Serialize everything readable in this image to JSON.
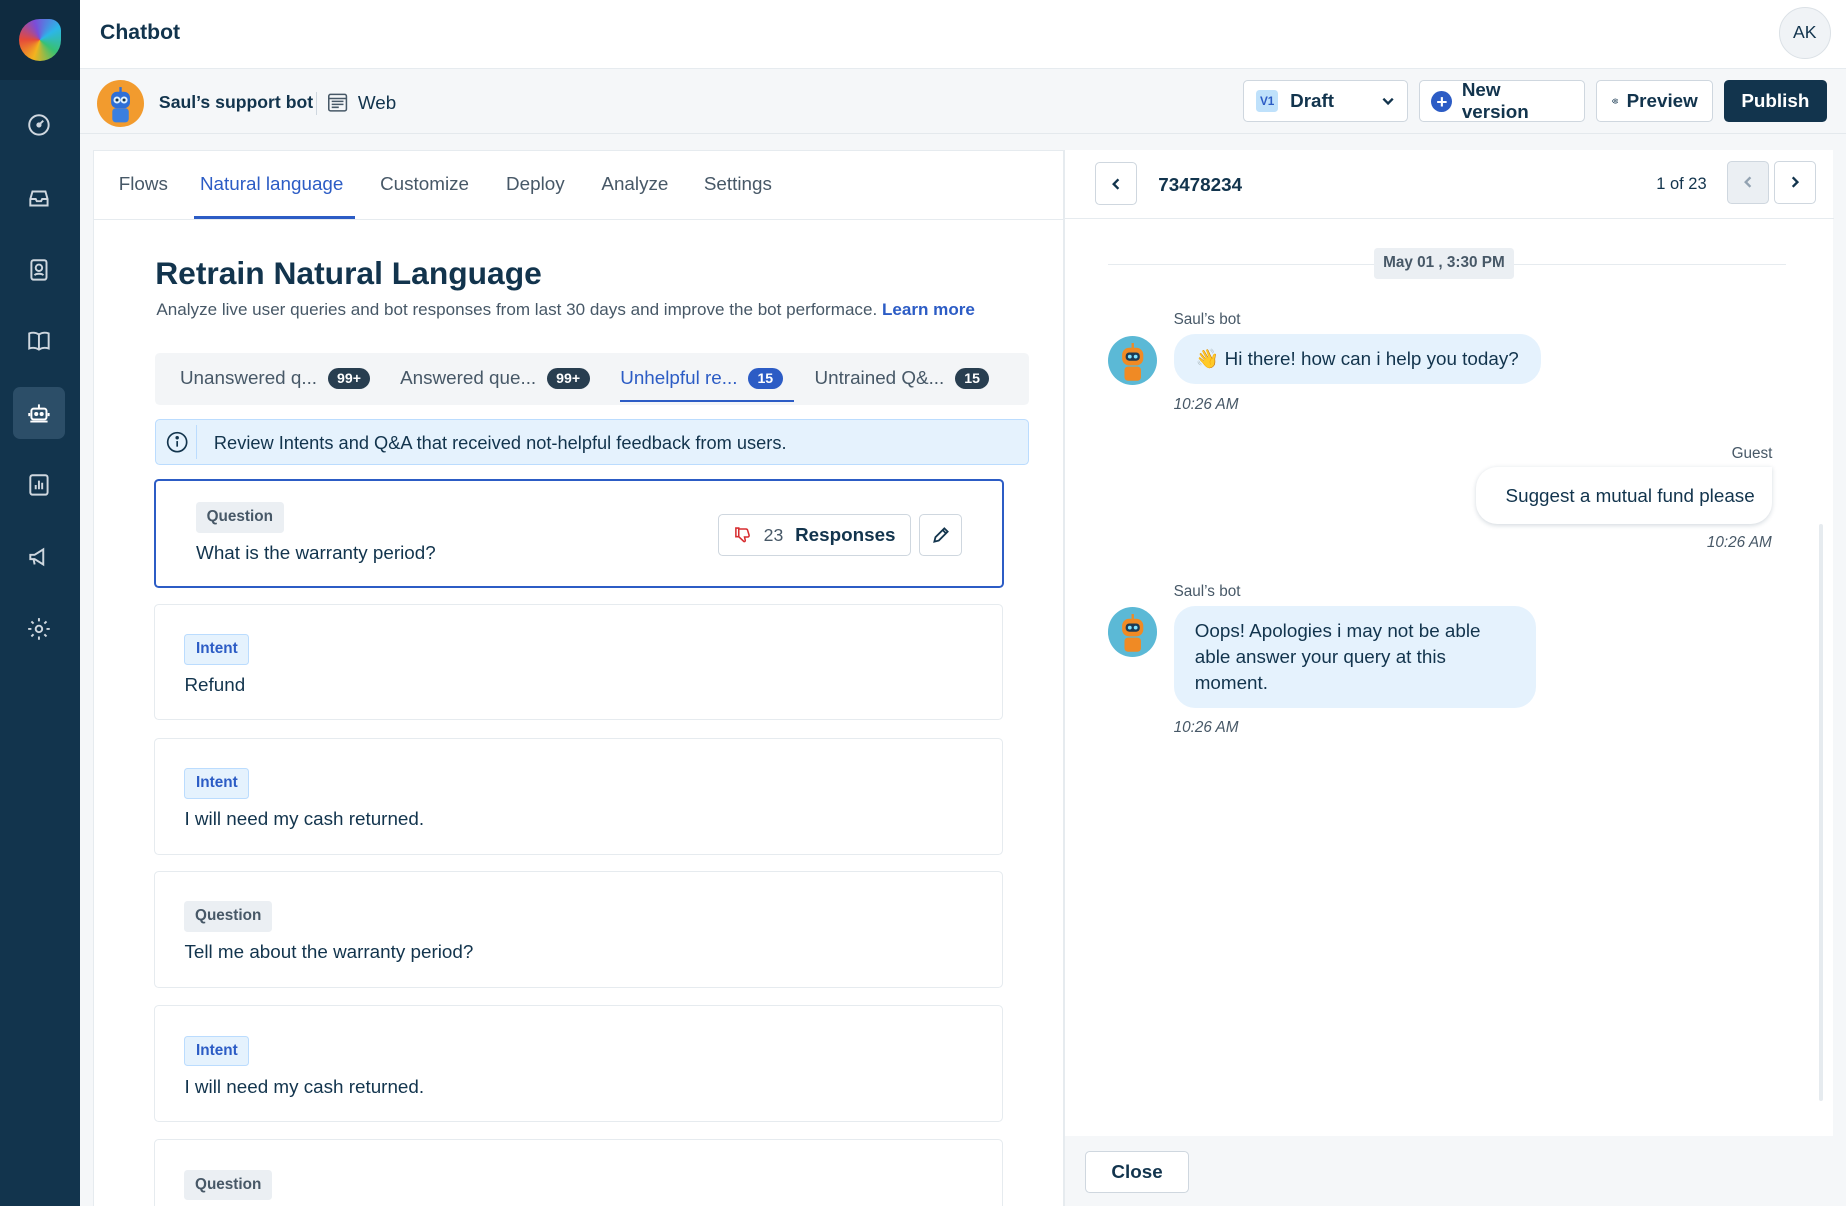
{
  "app": {
    "title": "Chatbot",
    "user_initials": "AK"
  },
  "rail": {
    "items": [
      "dashboard-icon",
      "inbox-icon",
      "contacts-icon",
      "knowledge-base-icon",
      "bot-icon",
      "reports-icon",
      "campaigns-icon",
      "settings-icon"
    ],
    "active": "bot-icon"
  },
  "bot": {
    "name": "Saul’s support bot",
    "channel": "Web"
  },
  "version": {
    "badge": "V1",
    "label": "Draft"
  },
  "actions": {
    "new_version": "New version",
    "preview": "Preview",
    "publish": "Publish"
  },
  "tabs": [
    {
      "label": "Flows"
    },
    {
      "label": "Natural language"
    },
    {
      "label": "Customize"
    },
    {
      "label": "Deploy"
    },
    {
      "label": "Analyze"
    },
    {
      "label": "Settings"
    }
  ],
  "active_tab": "Natural language",
  "page": {
    "title": "Retrain Natural Language",
    "description": "Analyze live user queries and bot responses from last 30 days and improve the bot performace.",
    "learn_more": "Learn more"
  },
  "subtabs": [
    {
      "label": "Unanswered q...",
      "count": "99+"
    },
    {
      "label": "Answered que...",
      "count": "99+"
    },
    {
      "label": "Unhelpful re...",
      "count": "15"
    },
    {
      "label": "Untrained Q&...",
      "count": "15"
    }
  ],
  "active_subtab": "Unhelpful re...",
  "info": "Review Intents and Q&A that received not-helpful feedback from users.",
  "cards": [
    {
      "type": "Question",
      "text": "What is the warranty period?",
      "responses_count": "23",
      "responses_label": "Responses"
    },
    {
      "type": "Intent",
      "text": "Refund"
    },
    {
      "type": "Intent",
      "text": "I will need my cash returned."
    },
    {
      "type": "Question",
      "text": "Tell me about the warranty period?"
    },
    {
      "type": "Intent",
      "text": "I will need my cash returned."
    },
    {
      "type": "Question",
      "text": ""
    }
  ],
  "conversation": {
    "id": "73478234",
    "pager": "1 of 23",
    "date": "May 01 , 3:30 PM",
    "messages": [
      {
        "sender": "Saul’s bot",
        "text": "👋 Hi there! how can i help you today?",
        "time": "10:26 AM"
      },
      {
        "sender": "Guest",
        "text": "Suggest a mutual fund please",
        "time": "10:26 AM"
      },
      {
        "sender": "Saul’s bot",
        "text": "Oops! Apologies i may not be able able answer your query at this moment.",
        "time": "10:26 AM"
      }
    ],
    "close_label": "Close"
  },
  "colors": {
    "accent": "#2c5cc5",
    "rail": "#12344d",
    "negative": "#d72d30"
  }
}
